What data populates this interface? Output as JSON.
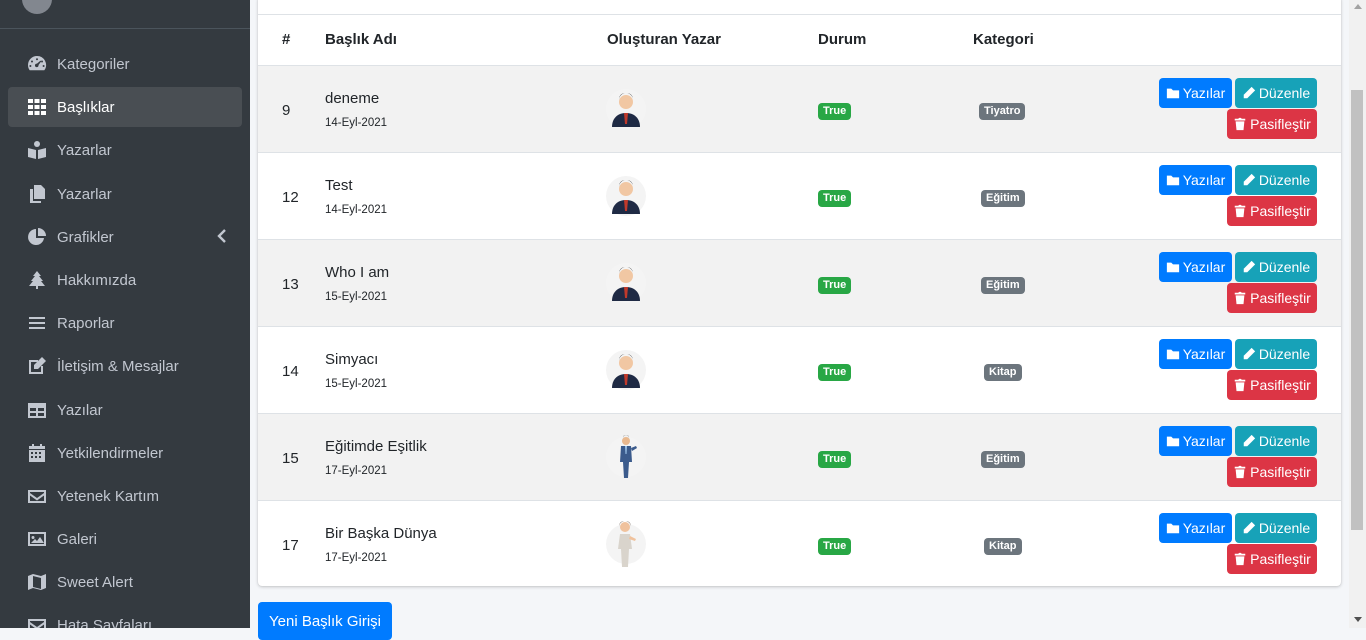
{
  "sidebar": {
    "items": [
      {
        "label": "Kategoriler",
        "icon": "dashboard-gauge-icon"
      },
      {
        "label": "Başlıklar",
        "icon": "grid-icon",
        "active": true
      },
      {
        "label": "Yazarlar",
        "icon": "book-reader-icon"
      },
      {
        "label": "Yazarlar",
        "icon": "copy-icon"
      },
      {
        "label": "Grafikler",
        "icon": "pie-chart-icon"
      },
      {
        "label": "Hakkımızda",
        "icon": "tree-icon"
      },
      {
        "label": "Raporlar",
        "icon": "bars-icon"
      },
      {
        "label": "İletişim & Mesajlar",
        "icon": "edit-icon"
      },
      {
        "label": "Yazılar",
        "icon": "table-icon"
      },
      {
        "label": "Yetkilendirmeler",
        "icon": "calendar-icon"
      },
      {
        "label": "Yetenek Kartım",
        "icon": "envelope-icon"
      },
      {
        "label": "Galeri",
        "icon": "image-icon"
      },
      {
        "label": "Sweet Alert",
        "icon": "map-icon"
      },
      {
        "label": "Hata Sayfaları",
        "icon": "envelope-icon"
      }
    ]
  },
  "table": {
    "headers": {
      "id": "#",
      "title": "Başlık Adı",
      "author": "Oluşturan Yazar",
      "status": "Durum",
      "category": "Kategori"
    },
    "rows": [
      {
        "id": "9",
        "title": "deneme",
        "date": "14-Eyl-2021",
        "author_avatar": "male-avatar",
        "status": "True",
        "category": "Tiyatro"
      },
      {
        "id": "12",
        "title": "Test",
        "date": "14-Eyl-2021",
        "author_avatar": "male-avatar",
        "status": "True",
        "category": "Eğitim"
      },
      {
        "id": "13",
        "title": "Who I am",
        "date": "15-Eyl-2021",
        "author_avatar": "male-avatar",
        "status": "True",
        "category": "Eğitim"
      },
      {
        "id": "14",
        "title": "Simyacı",
        "date": "15-Eyl-2021",
        "author_avatar": "male-avatar",
        "status": "True",
        "category": "Kitap"
      },
      {
        "id": "15",
        "title": "Eğitimde Eşitlik",
        "date": "17-Eyl-2021",
        "author_avatar": "standing-man-avatar",
        "status": "True",
        "category": "Eğitim"
      },
      {
        "id": "17",
        "title": "Bir Başka Dünya",
        "date": "17-Eyl-2021",
        "author_avatar": "standing-woman-avatar",
        "status": "True",
        "category": "Kitap"
      }
    ],
    "actions": {
      "posts": "Yazılar",
      "edit": "Düzenle",
      "deactivate": "Pasifleştir"
    }
  },
  "new_button": "Yeni Başlık Girişi",
  "colors": {
    "sidebar": "#343a40",
    "primary": "#007bff",
    "info": "#17a2b8",
    "danger": "#dc3545",
    "success": "#28a745",
    "secondary": "#6c757d"
  }
}
